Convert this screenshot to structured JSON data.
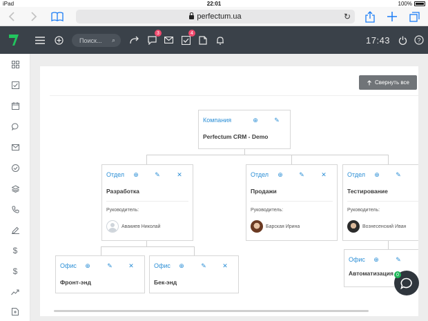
{
  "statusbar": {
    "device": "iPad",
    "time": "22:01",
    "battery": "100%"
  },
  "safari": {
    "url": "perfectum.ua"
  },
  "appbar": {
    "search_placeholder": "Поиск...",
    "badge_chat": "3",
    "badge_tasks": "4",
    "clock": "17:43"
  },
  "toolbar": {
    "collapse_label": "Свернуть все"
  },
  "org": {
    "root": {
      "type": "Компания",
      "name": "Perfectum CRM - Demo"
    },
    "depts": [
      {
        "type": "Отдел",
        "name": "Разработка",
        "lead_label": "Руководитель:",
        "lead": "Авакиев Николай"
      },
      {
        "type": "Отдел",
        "name": "Продажи",
        "lead_label": "Руководитель:",
        "lead": "Барская Ирина"
      },
      {
        "type": "Отдел",
        "name": "Тестирование",
        "lead_label": "Руководитель:",
        "lead": "Вознесенский Иван"
      }
    ],
    "offices": [
      {
        "type": "Офис",
        "name": "Фронт-энд"
      },
      {
        "type": "Офис",
        "name": "Бек-энд"
      },
      {
        "type": "Офис",
        "name": "Автоматизация"
      }
    ]
  },
  "chat": {
    "badge": "0"
  },
  "colors": {
    "appbar": "#3a4149",
    "accent": "#2c8fd6",
    "badge": "#f14a6e",
    "logo": "#22c55e"
  }
}
